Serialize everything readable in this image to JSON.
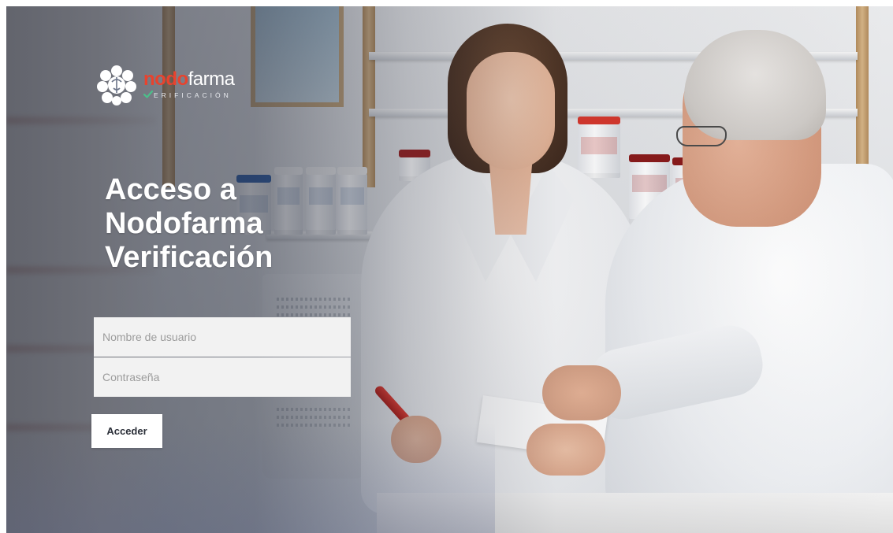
{
  "brand": {
    "name_accent": "nodo",
    "name_rest": "farma",
    "subtitle": "ERIFICACIÓN",
    "logo_icon": "nodofarma-node-cluster-icon",
    "check_icon": "check-icon",
    "accent_color": "#e8432e",
    "check_color": "#4bbf8a"
  },
  "login": {
    "title_lines": [
      "Acceso a",
      "Nodofarma",
      "Verificación"
    ],
    "username_placeholder": "Nombre de usuario",
    "password_placeholder": "Contraseña",
    "submit_label": "Acceder"
  }
}
